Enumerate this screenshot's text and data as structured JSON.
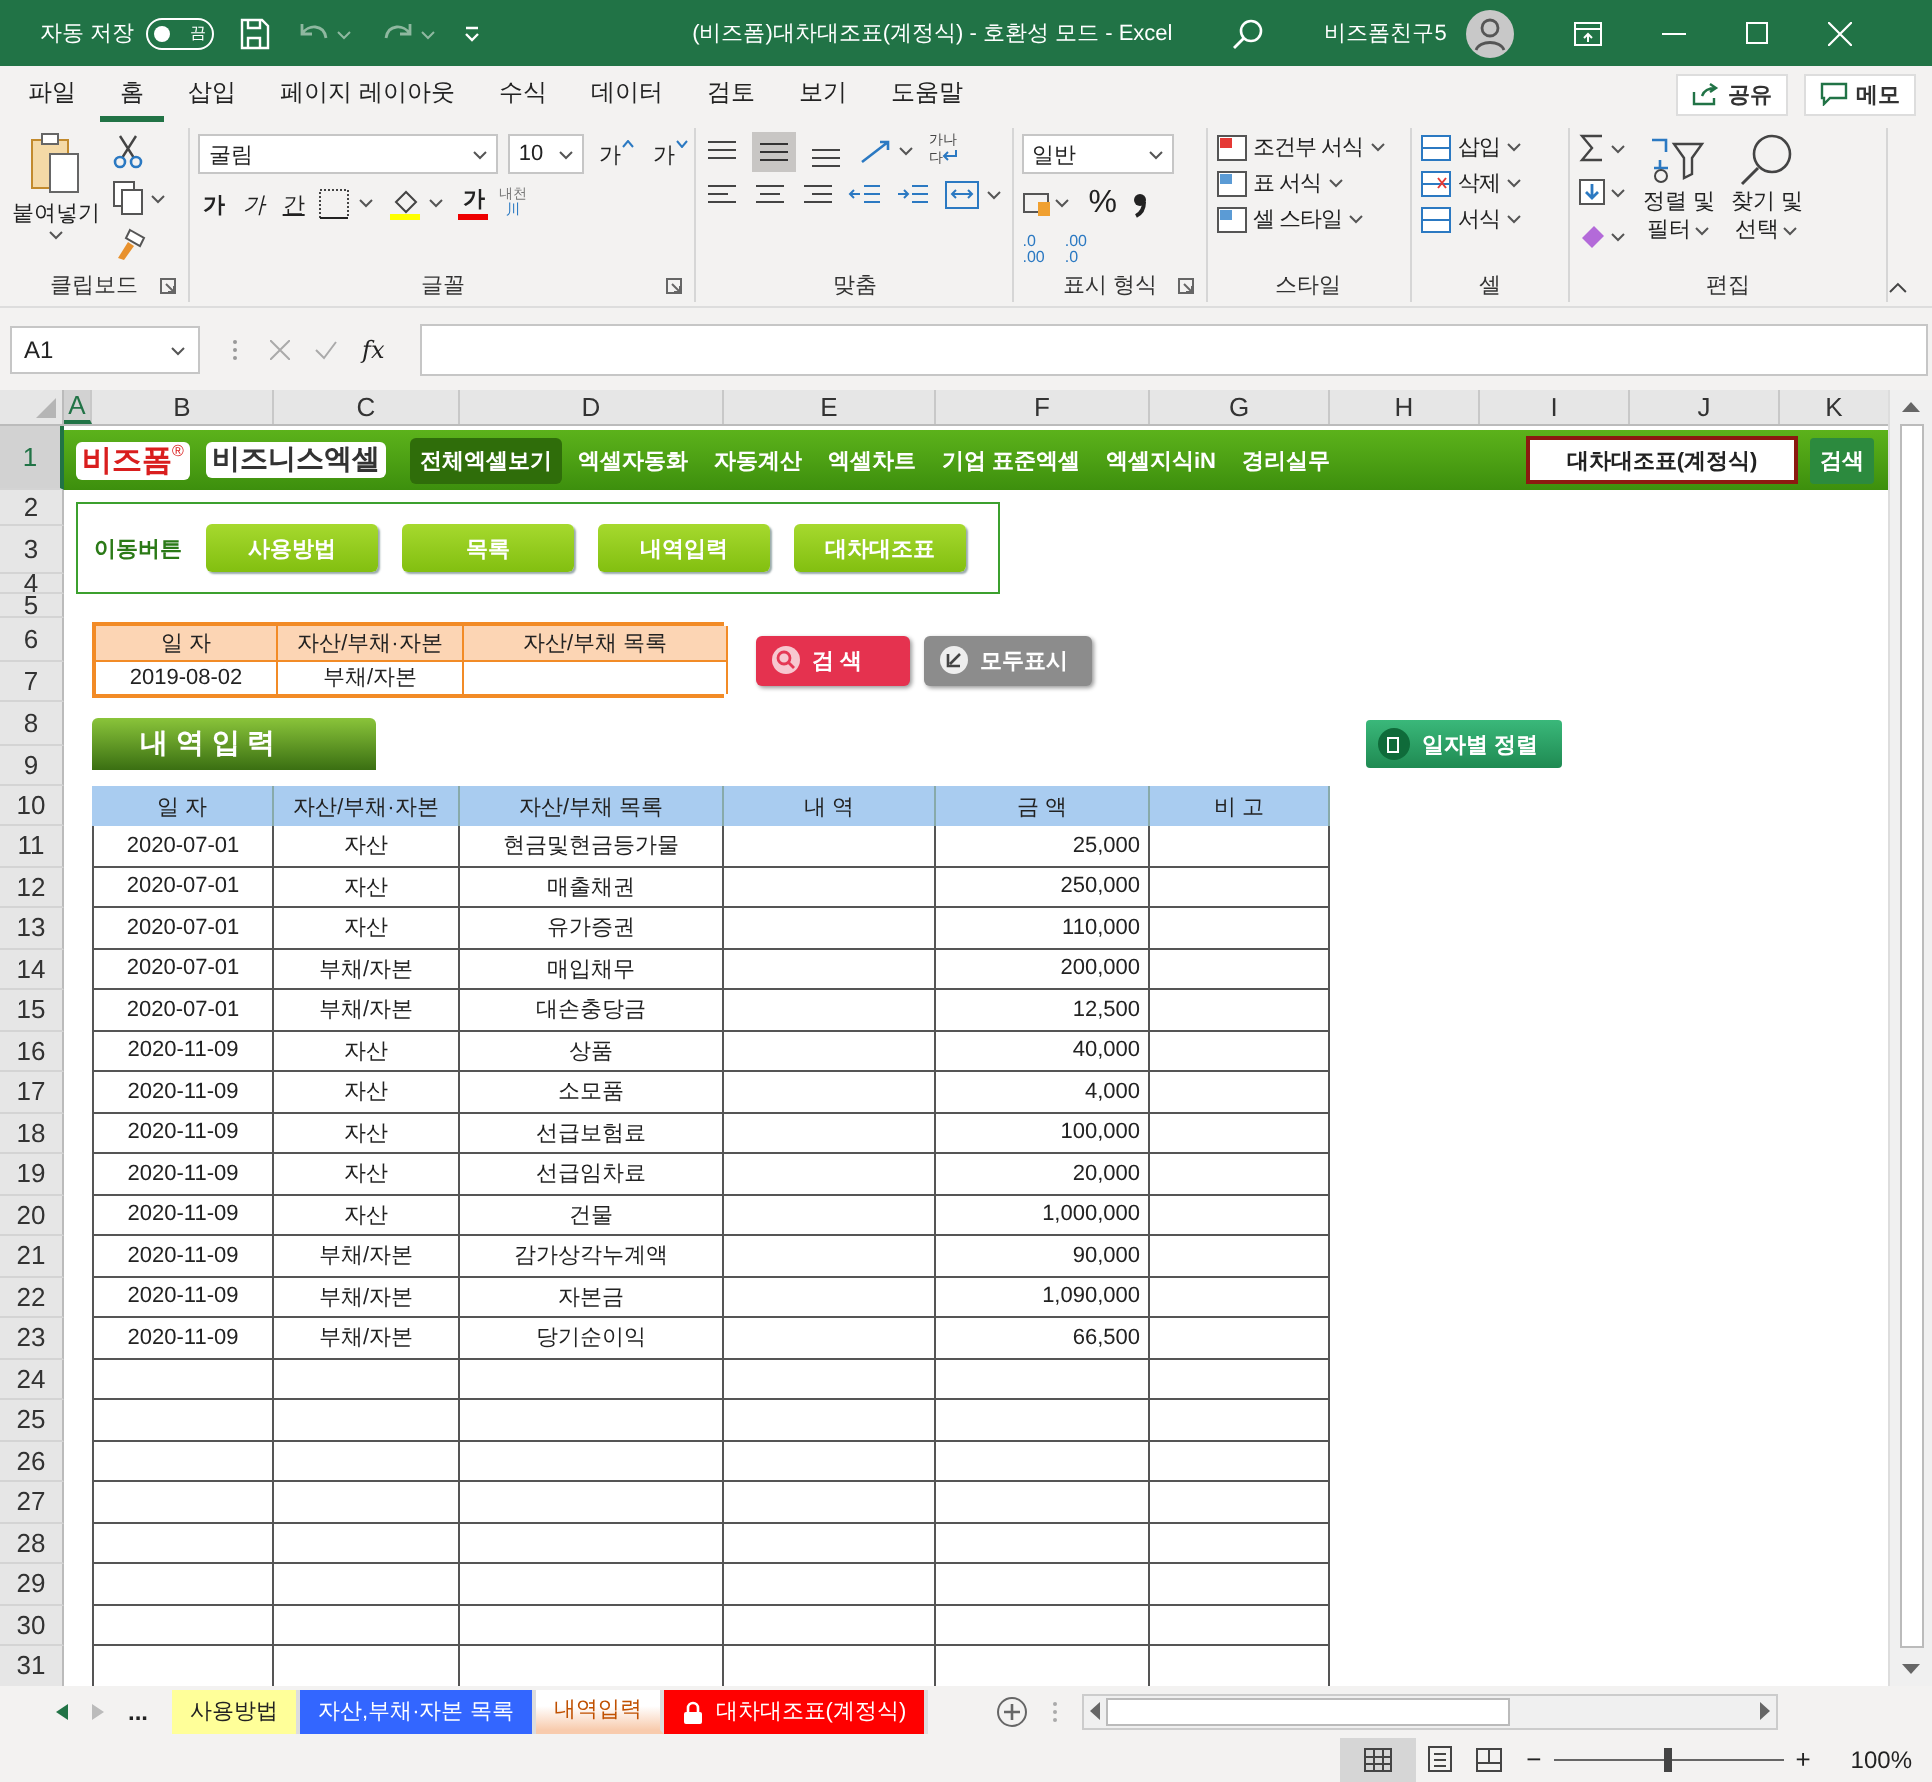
{
  "title_bar": {
    "autosave_label": "자동 저장",
    "autosave_toggle": {
      "label": "끔",
      "on": false
    },
    "title": "(비즈폼)대차대조표(계정식) - 호환성 모드 - Excel",
    "user": "비즈폼친구5"
  },
  "menu_tabs": [
    {
      "label": "파일",
      "selected": false
    },
    {
      "label": "홈",
      "selected": true
    },
    {
      "label": "삽입",
      "selected": false
    },
    {
      "label": "페이지 레이아웃",
      "selected": false
    },
    {
      "label": "수식",
      "selected": false
    },
    {
      "label": "데이터",
      "selected": false
    },
    {
      "label": "검토",
      "selected": false
    },
    {
      "label": "보기",
      "selected": false
    },
    {
      "label": "도움말",
      "selected": false
    }
  ],
  "share_button": "공유",
  "memo_button": "메모",
  "ribbon": {
    "clipboard": {
      "paste": "붙여넣기",
      "group": "클립보드"
    },
    "font": {
      "name": "굴림",
      "size": "10",
      "grow": "가",
      "shrink": "가",
      "bold": "가",
      "italic": "가",
      "underline": "간",
      "font_color": "가",
      "phonetic": [
        "내천",
        "川"
      ],
      "group": "글꼴"
    },
    "alignment": {
      "wrap": [
        "가나",
        "다"
      ],
      "group": "맞춤"
    },
    "number": {
      "format": "일반",
      "percent": "%",
      "decimal_increase": [
        ".0",
        ".00"
      ],
      "decimal_decrease": [
        ".00",
        ".0"
      ],
      "group": "표시 형식"
    },
    "styles": {
      "items": [
        "조건부 서식",
        "표 서식",
        "셀 스타일"
      ],
      "group": "스타일"
    },
    "cells": {
      "items": [
        "삽입",
        "삭제",
        "서식"
      ],
      "group": "셀"
    },
    "editing": {
      "sort": [
        "정렬 및",
        "필터"
      ],
      "find": [
        "찾기 및",
        "선택"
      ],
      "group": "편집"
    }
  },
  "formula_bar": {
    "name_box": "A1",
    "fx": "fx"
  },
  "column_headers": [
    "A",
    "B",
    "C",
    "D",
    "E",
    "F",
    "G",
    "H",
    "I",
    "J",
    "K"
  ],
  "row_headers": [
    "1",
    "2",
    "3",
    "4",
    "5",
    "6",
    "7",
    "8",
    "9",
    "10",
    "11",
    "12",
    "13",
    "14",
    "15",
    "16",
    "17",
    "18",
    "19",
    "20",
    "21",
    "22",
    "23",
    "24",
    "25",
    "26",
    "27",
    "28",
    "29",
    "30",
    "31"
  ],
  "banner": {
    "logo": "비즈폼",
    "logo_mark": "®",
    "brand": "비즈니스엑셀",
    "nav": [
      {
        "label": "전체엑셀보기",
        "selected": true
      },
      {
        "label": "엑셀자동화",
        "selected": false
      },
      {
        "label": "자동계산",
        "selected": false
      },
      {
        "label": "엑셀차트",
        "selected": false
      },
      {
        "label": "기업 표준엑셀",
        "selected": false
      },
      {
        "label": "엑셀지식iN",
        "selected": false
      },
      {
        "label": "경리실무",
        "selected": false
      }
    ],
    "search_value": "대차대조표(계정식)",
    "search_button": "검색"
  },
  "move_buttons": {
    "label": "이동버튼",
    "buttons": [
      "사용방법",
      "목록",
      "내역입력",
      "대차대조표"
    ]
  },
  "search_form": {
    "columns": [
      "일 자",
      "자산/부채·자본",
      "자산/부채 목록"
    ],
    "values": [
      "2019-08-02",
      "부채/자본"
    ]
  },
  "actions": {
    "search": "검 색",
    "show_all": "모두표시"
  },
  "section_title": "내 역 입 력",
  "sort_button": "일자별 정렬",
  "table": {
    "columns": [
      "일 자",
      "자산/부채·자본",
      "자산/부채 목록",
      "내 역",
      "금 액",
      "비 고"
    ],
    "rows": [
      {
        "date": "2020-07-01",
        "type": "자산",
        "account": "현금및현금등가물",
        "amount": "25,000"
      },
      {
        "date": "2020-07-01",
        "type": "자산",
        "account": "매출채권",
        "amount": "250,000"
      },
      {
        "date": "2020-07-01",
        "type": "자산",
        "account": "유가증권",
        "amount": "110,000"
      },
      {
        "date": "2020-07-01",
        "type": "부채/자본",
        "account": "매입채무",
        "amount": "200,000"
      },
      {
        "date": "2020-07-01",
        "type": "부채/자본",
        "account": "대손충당금",
        "amount": "12,500"
      },
      {
        "date": "2020-11-09",
        "type": "자산",
        "account": "상품",
        "amount": "40,000"
      },
      {
        "date": "2020-11-09",
        "type": "자산",
        "account": "소모품",
        "amount": "4,000"
      },
      {
        "date": "2020-11-09",
        "type": "자산",
        "account": "선급보험료",
        "amount": "100,000"
      },
      {
        "date": "2020-11-09",
        "type": "자산",
        "account": "선급임차료",
        "amount": "20,000"
      },
      {
        "date": "2020-11-09",
        "type": "자산",
        "account": "건물",
        "amount": "1,000,000"
      },
      {
        "date": "2020-11-09",
        "type": "부채/자본",
        "account": "감가상각누계액",
        "amount": "90,000"
      },
      {
        "date": "2020-11-09",
        "type": "부채/자본",
        "account": "자본금",
        "amount": "1,090,000"
      },
      {
        "date": "2020-11-09",
        "type": "부채/자본",
        "account": "당기순이익",
        "amount": "66,500"
      }
    ]
  },
  "sheet_tabs": {
    "more": "...",
    "tabs": [
      {
        "label": "사용방법",
        "color": "#ffff99",
        "selected": false,
        "locked": false
      },
      {
        "label": "자산,부채·자본 목록",
        "color": "#3366ff",
        "selected": false,
        "locked": false
      },
      {
        "label": "내역입력",
        "color": "#f8cbad",
        "selected": true,
        "locked": false
      },
      {
        "label": "대차대조표(계정식)",
        "color": "#ff0000",
        "selected": false,
        "locked": true
      }
    ]
  },
  "status_bar": {
    "zoom_minus": "−",
    "zoom_plus": "+",
    "zoom": "100%",
    "zoom_slider": {
      "level": 0.5
    }
  }
}
